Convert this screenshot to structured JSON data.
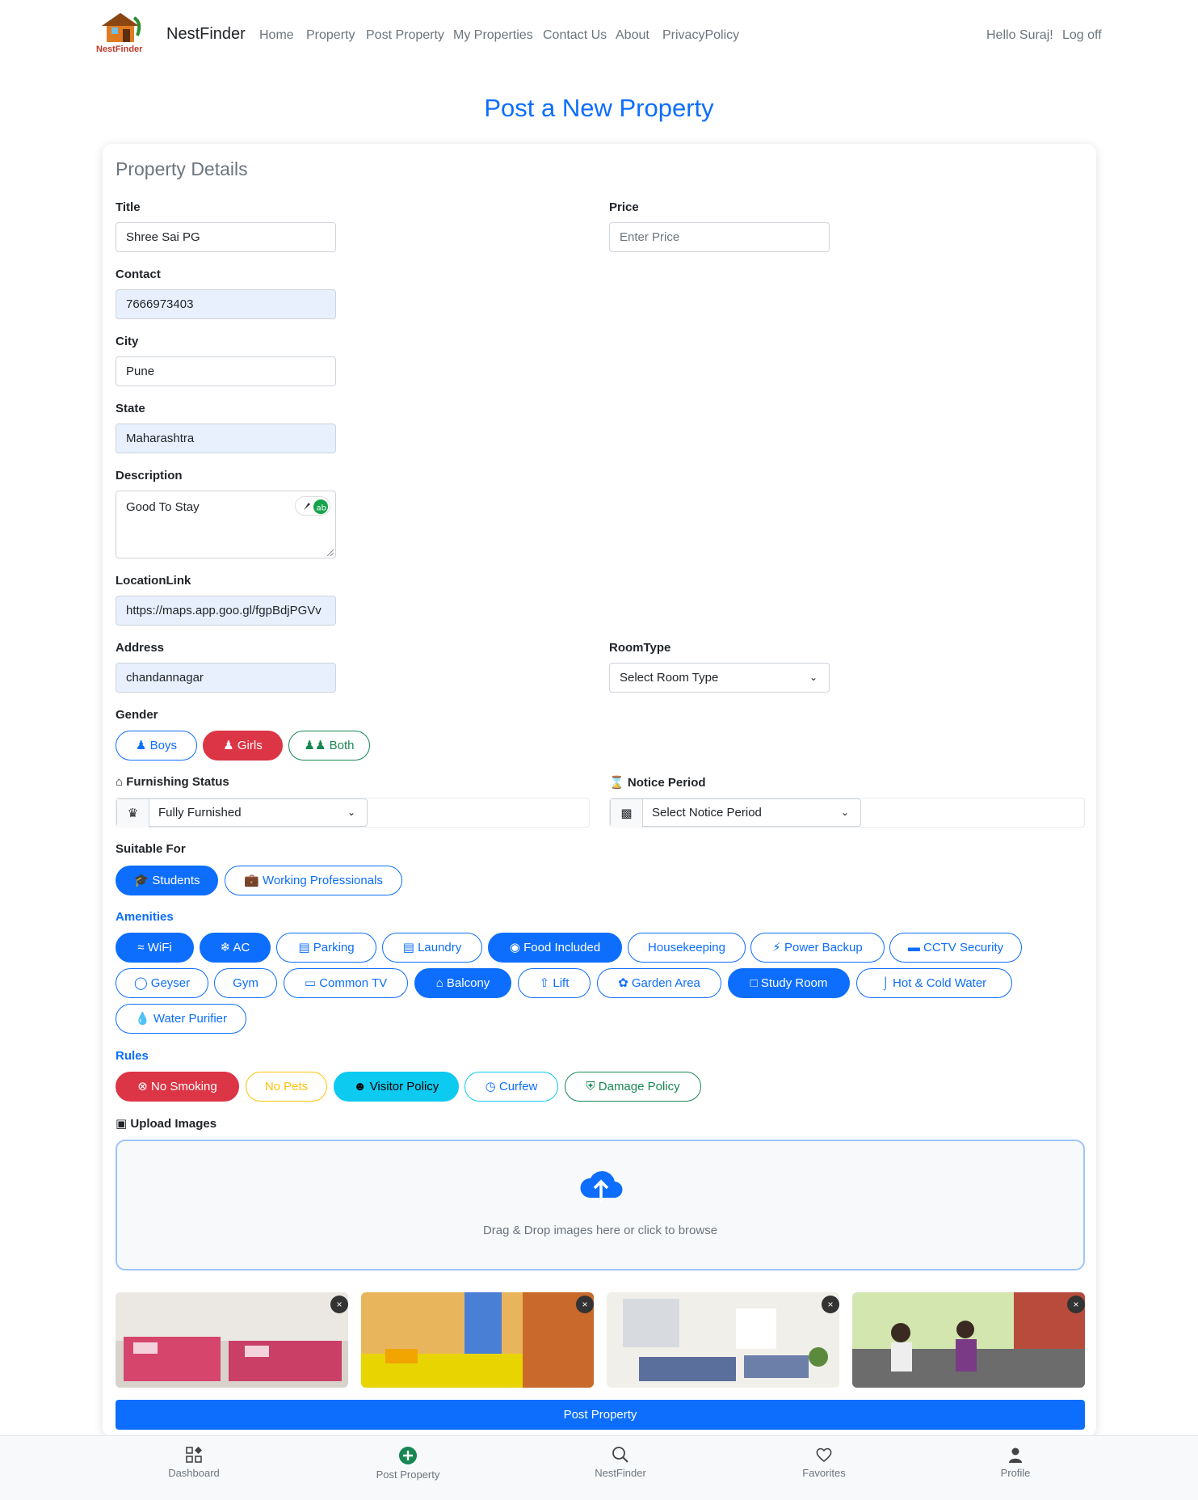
{
  "nav": {
    "brand": "NestFinder",
    "logo_text": "NestFinder",
    "links": [
      "Home",
      "Property",
      "Post Property",
      "My Properties",
      "Contact Us",
      "About",
      "PrivacyPolicy"
    ],
    "greeting": "Hello Suraj!",
    "logoff": "Log off"
  },
  "page": {
    "title": "Post a New Property"
  },
  "card": {
    "title": "Property Details"
  },
  "form": {
    "title": {
      "label": "Title",
      "value": "Shree Sai PG"
    },
    "price": {
      "label": "Price",
      "placeholder": "Enter Price"
    },
    "contact": {
      "label": "Contact",
      "value": "7666973403"
    },
    "city": {
      "label": "City",
      "value": "Pune"
    },
    "state": {
      "label": "State",
      "value": "Maharashtra"
    },
    "description": {
      "label": "Description",
      "value": "Good To Stay"
    },
    "location": {
      "label": "LocationLink",
      "value": "https://maps.app.goo.gl/fgpBdjPGVv"
    },
    "address": {
      "label": "Address",
      "value": "chandannagar"
    },
    "roomtype": {
      "label": "RoomType",
      "value": "Select Room Type"
    },
    "gender": {
      "label": "Gender",
      "options": [
        "Boys",
        "Girls",
        "Both"
      ],
      "selected": "Girls"
    },
    "furnishing": {
      "label": "Furnishing Status",
      "value": "Fully Furnished"
    },
    "notice": {
      "label": "Notice Period",
      "value": "Select Notice Period"
    },
    "suitable": {
      "label": "Suitable For",
      "options": [
        "Students",
        "Working Professionals"
      ],
      "selected": [
        "Students"
      ]
    },
    "amenities": {
      "label": "Amenities",
      "items": [
        "WiFi",
        "AC",
        "Parking",
        "Laundry",
        "Food Included",
        "Housekeeping",
        "Power Backup",
        "CCTV Security",
        "Geyser",
        "Gym",
        "Common TV",
        "Balcony",
        "Lift",
        "Garden Area",
        "Study Room",
        "Hot & Cold Water",
        "Water Purifier"
      ],
      "selected": [
        "WiFi",
        "AC",
        "Food Included",
        "Balcony",
        "Study Room"
      ]
    },
    "rules": {
      "label": "Rules",
      "items": [
        "No Smoking",
        "No Pets",
        "Visitor Policy",
        "Curfew",
        "Damage Policy"
      ],
      "selected": [
        "No Smoking",
        "Visitor Policy"
      ]
    },
    "upload": {
      "label": "Upload Images",
      "dropzone_text": "Drag & Drop images here or click to browse",
      "image_count": 4
    },
    "submit": "Post Property"
  },
  "bottom_nav": [
    {
      "label": "Dashboard",
      "icon": "dashboard-icon"
    },
    {
      "label": "Post Property",
      "icon": "plus-circle-icon"
    },
    {
      "label": "NestFinder",
      "icon": "search-icon"
    },
    {
      "label": "Favorites",
      "icon": "heart-icon"
    },
    {
      "label": "Profile",
      "icon": "user-icon"
    }
  ],
  "colors": {
    "primary": "#0d6efd",
    "danger": "#dc3545",
    "success": "#198754",
    "warning": "#ffc107",
    "info": "#0dcaf0"
  }
}
